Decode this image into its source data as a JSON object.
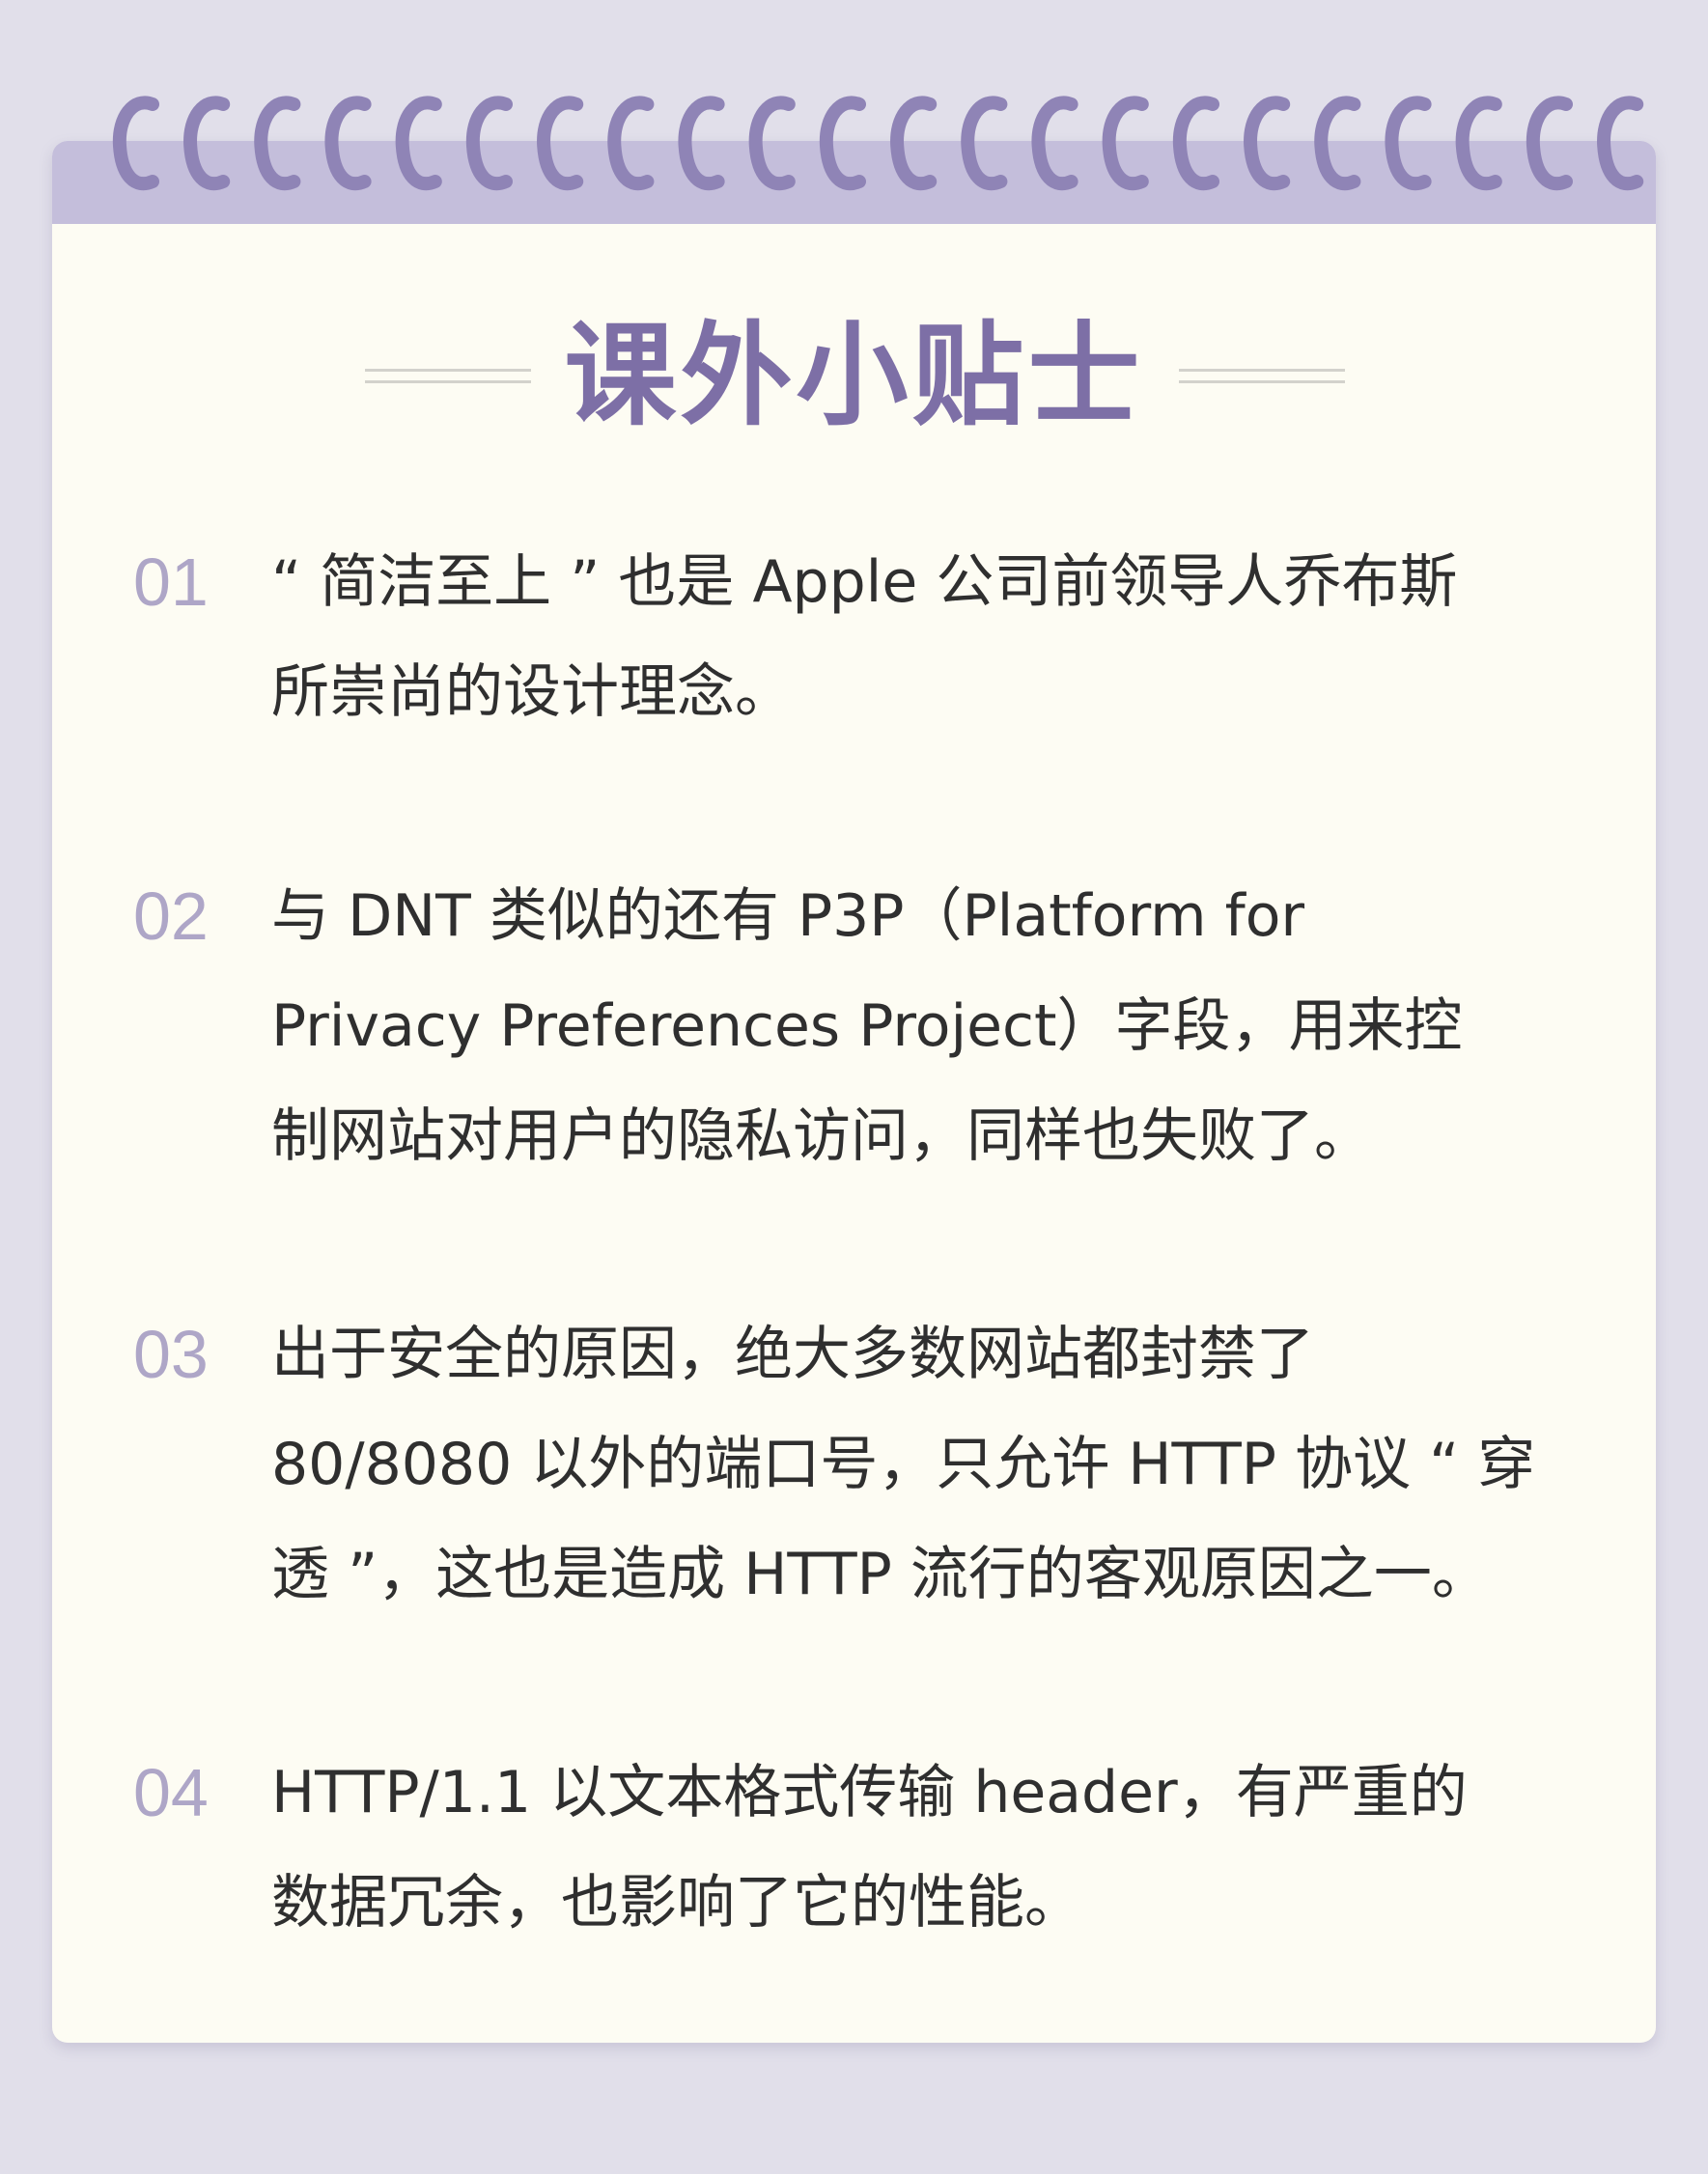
{
  "title": "课外小贴士",
  "tips": [
    {
      "num": "01",
      "lines": [
        "“ 简洁至上 ” 也是 Apple 公司前领导人乔布斯",
        "所崇尚的设计理念。"
      ]
    },
    {
      "num": "02",
      "lines": [
        "与 DNT 类似的还有 P3P（Platform for",
        "Privacy Preferences Project）字段，用来控",
        "制网站对用户的隐私访问，同样也失败了。"
      ]
    },
    {
      "num": "03",
      "lines": [
        "出于安全的原因，绝大多数网站都封禁了",
        "80/8080 以外的端口号，只允许 HTTP 协议 “ 穿",
        "透 ”，这也是造成 HTTP 流行的客观原因之一。"
      ]
    },
    {
      "num": "04",
      "lines": [
        "HTTP/1.1 以文本格式传输 header，有严重的",
        "数据冗余，也影响了它的性能。"
      ]
    }
  ],
  "colors": {
    "background": "#e1dfea",
    "card": "#fdfcf3",
    "band": "#c4bedb",
    "ring": "#8f84b6",
    "title": "#7d6fa6",
    "number": "#aea6c7",
    "text": "#2f2f2f"
  }
}
